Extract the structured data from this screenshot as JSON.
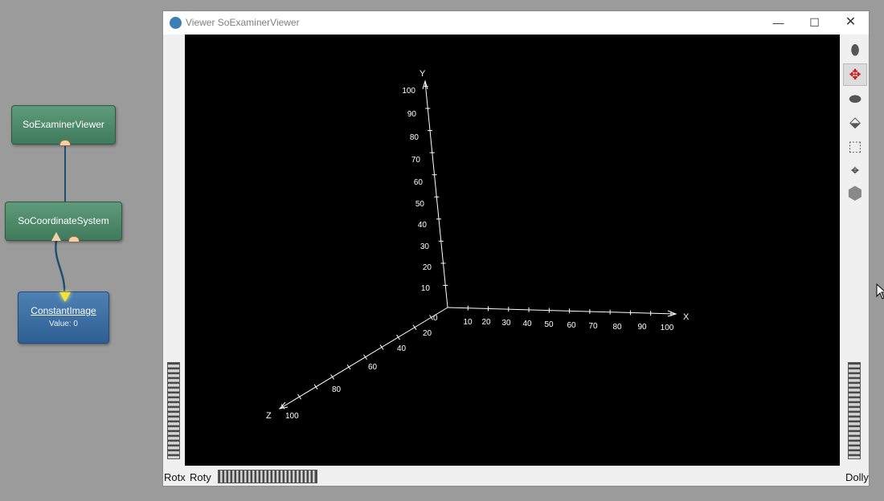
{
  "network": {
    "nodes": {
      "viewer": "SoExaminerViewer",
      "coordinate_system": "SoCoordinateSystem",
      "constant_image": "ConstantImage",
      "constant_image_value": "Value: 0"
    }
  },
  "window": {
    "title": "Viewer SoExaminerViewer",
    "controls": {
      "minimize": "—",
      "maximize": "☐",
      "close": "✕"
    }
  },
  "scene": {
    "axes": {
      "x_label": "X",
      "y_label": "Y",
      "z_label": "Z",
      "x_ticks": [
        "10",
        "20",
        "30",
        "40",
        "50",
        "60",
        "70",
        "80",
        "90",
        "100"
      ],
      "y_ticks": [
        "10",
        "20",
        "30",
        "40",
        "50",
        "60",
        "70",
        "80",
        "90",
        "100"
      ],
      "z_ticks": [
        "20",
        "40",
        "60",
        "80",
        "100"
      ],
      "origin_label": "0"
    }
  },
  "bottom": {
    "rotx_label": "Rotx",
    "roty_label": "Roty",
    "dolly_label": "Dolly"
  },
  "toolbar": {
    "icons": [
      "pick-icon",
      "view-icon",
      "home-icon",
      "set-home-icon",
      "view-all-icon",
      "seek-icon",
      "camera-icon"
    ]
  },
  "colors": {
    "viewport_background": "#000000",
    "axis_color": "#ffffff",
    "node_green": "#4a8766",
    "node_blue": "#3a6ea5"
  }
}
